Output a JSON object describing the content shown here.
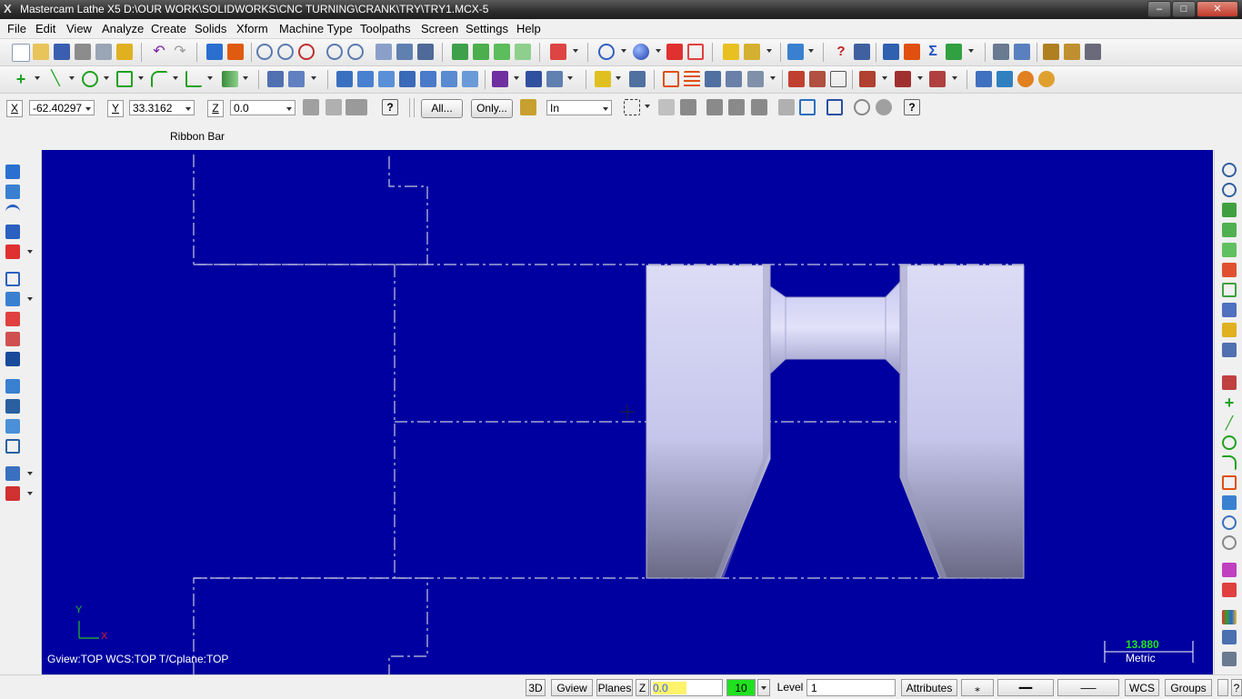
{
  "window": {
    "title": "Mastercam Lathe X5  D:\\OUR WORK\\SOLIDWORKS\\CNC TURNING\\CRANK\\TRY\\TRY1.MCX-5",
    "minimize": "–",
    "maximize": "□",
    "close": "✕"
  },
  "menu": [
    "File",
    "Edit",
    "View",
    "Analyze",
    "Create",
    "Solids",
    "Xform",
    "Machine Type",
    "Toolpaths",
    "Screen",
    "Settings",
    "Help"
  ],
  "ribbon": {
    "x_label": "X",
    "x_value": "-62.40297",
    "y_label": "Y",
    "y_value": "33.3162",
    "z_label": "Z",
    "z_value": "0.0",
    "all_button": "All...",
    "only_button": "Only...",
    "mode_value": "In",
    "ribbon_bar_label": "Ribbon Bar"
  },
  "viewport": {
    "axis_y": "Y",
    "axis_x": "X",
    "views_text": "Gview:TOP   WCS:TOP   T/Cplane:TOP",
    "scale_value": "13.880",
    "scale_unit": "Metric",
    "background": "#0000a0"
  },
  "status": {
    "btn_3d": "3D",
    "btn_gview": "Gview",
    "btn_planes": "Planes",
    "z_label": "Z",
    "z_value": "0.0",
    "color_value": "10",
    "level_label": "Level",
    "level_value": "1",
    "btn_attributes": "Attributes",
    "btn_wcs": "WCS",
    "btn_groups": "Groups"
  }
}
